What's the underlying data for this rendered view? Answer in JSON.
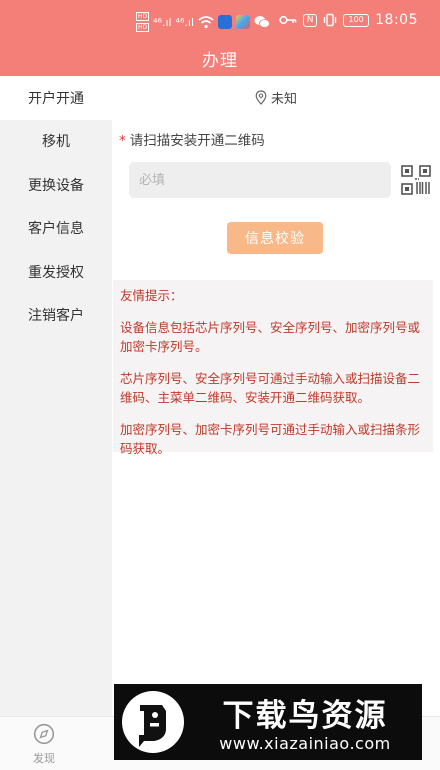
{
  "status_bar": {
    "badge_top": "HD",
    "badge_bottom": "HD",
    "signal_1": "⁴⁶.ıl",
    "signal_2": "⁴⁶.ıl",
    "nfc": "N",
    "battery": "100",
    "time": "18:05"
  },
  "header": {
    "title": "办理"
  },
  "sidebar": {
    "items": [
      {
        "label": "开户开通",
        "active": true
      },
      {
        "label": "移机",
        "active": false
      },
      {
        "label": "更换设备",
        "active": false
      },
      {
        "label": "客户信息",
        "active": false
      },
      {
        "label": "重发授权",
        "active": false
      },
      {
        "label": "注销客户",
        "active": false
      }
    ]
  },
  "location": {
    "icon": "location-pin-icon",
    "text": "未知"
  },
  "form": {
    "required_mark": "*",
    "scan_label": "请扫描安装开通二维码",
    "input_placeholder": "必填",
    "input_value": "",
    "verify_label": "信息校验"
  },
  "tips": {
    "title": "友情提示：",
    "lines": [
      "设备信息包括芯片序列号、安全序列号、加密序列号或加密卡序列号。",
      "芯片序列号、安全序列号可通过手动输入或扫描设备二维码、主菜单二维码、安装开通二维码获取。",
      "加密序列号、加密卡序列号可通过手动输入或扫描条形码获取。"
    ]
  },
  "bottom_nav": {
    "items": [
      {
        "label": "发现",
        "icon": "discover-icon"
      }
    ]
  },
  "watermark": {
    "main": "下载鸟资源",
    "url": "www.xiazainiao.com"
  },
  "colors": {
    "header": "#f47f78",
    "sidebar": "#f2f2f2",
    "verify_button": "#f8b888",
    "tips_text": "#c0392b",
    "required": "#e4393c"
  }
}
